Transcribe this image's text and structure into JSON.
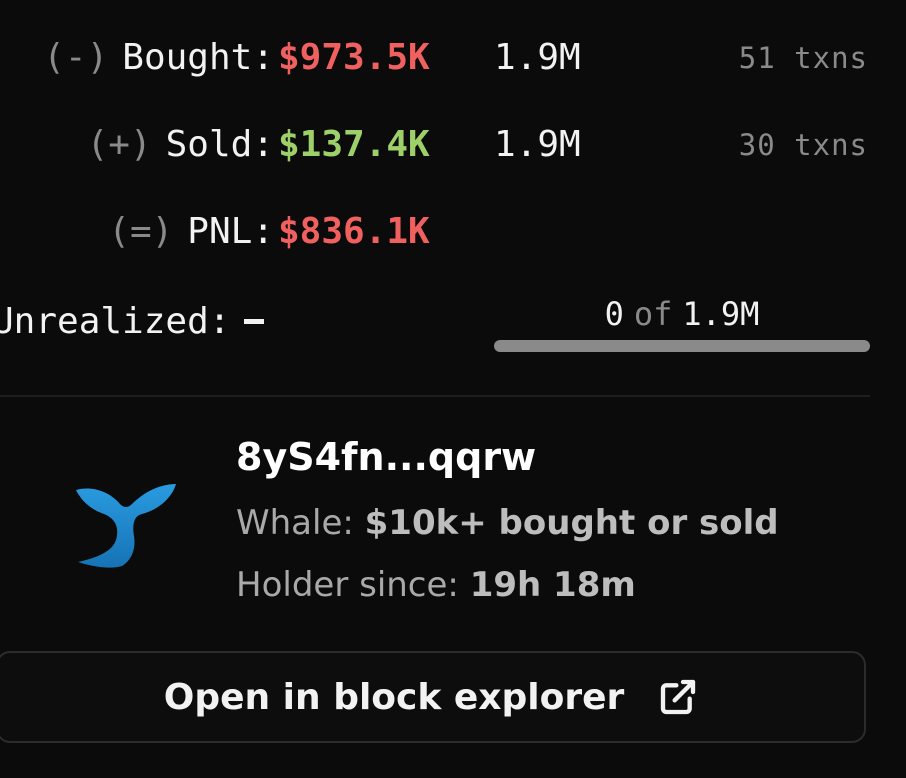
{
  "trades": [
    {
      "sign": "(-)",
      "label": "Bought:",
      "amount": "$973.5K",
      "quantity": "1.9M",
      "txns": "51 txns",
      "amount_color": "#f0605f"
    },
    {
      "sign": "(+)",
      "label": "Sold:",
      "amount": "$137.4K",
      "quantity": "1.9M",
      "txns": "30 txns",
      "amount_color": "#9ed06a"
    },
    {
      "sign": "(=)",
      "label": "PNL:",
      "amount": "$836.1K",
      "quantity": "",
      "txns": "",
      "amount_color": "#f0605f"
    }
  ],
  "unrealized": {
    "label": "Unrealized:",
    "held": "0",
    "of_word": "of",
    "total": "1.9M",
    "progress_fraction": 0
  },
  "wallet": {
    "icon": "whale-icon",
    "address": "8yS4fn...qqrw",
    "class_label": "Whale:",
    "class_value": "$10k+ bought or sold",
    "since_label": "Holder since:",
    "since_value": "19h 18m"
  },
  "actions": {
    "explorer_label": "Open in block explorer",
    "explorer_icon": "external-link-icon"
  },
  "colors": {
    "loss": "#f0605f",
    "gain": "#9ed06a",
    "whale": "#1f8fd6"
  }
}
